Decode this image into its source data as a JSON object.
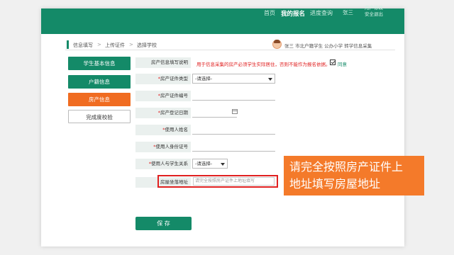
{
  "header": {
    "nav": [
      "首页",
      "我的报名",
      "进度查询"
    ],
    "active_index": 1,
    "user": "张三",
    "right_links": [
      "用户修改",
      "安全退出"
    ]
  },
  "breadcrumb": {
    "items": [
      "信息填写",
      "上传证件",
      "选择学校"
    ],
    "separator": ">",
    "user_info": "张三  市北户籍学生 公办小学 转学信息采集"
  },
  "sidebar": {
    "items": [
      {
        "label": "学生基本信息",
        "style": "green"
      },
      {
        "label": "户籍信息",
        "style": "green"
      },
      {
        "label": "房产信息",
        "style": "orange"
      },
      {
        "label": "完成度校验",
        "style": "plain"
      }
    ]
  },
  "form": {
    "notice_label": "房产信息填写说明",
    "notice_text": "用于信息采集的房产必须学生实际居住，否则不能作为报名依据。",
    "agree_label": "同意",
    "fields": [
      {
        "label": "房产证件类型",
        "required": true,
        "value": "-请选择-"
      },
      {
        "label": "房产证件编号",
        "required": true,
        "value": ""
      },
      {
        "label": "房产登记日期",
        "required": true,
        "value": ""
      },
      {
        "label": "使用人姓名",
        "required": true,
        "value": ""
      },
      {
        "label": "使用人身份证号",
        "required": true,
        "value": ""
      },
      {
        "label": "使用人与学生关系",
        "required": true,
        "value": "-请选择-"
      }
    ],
    "address_label": "房屋坐落地址",
    "address_placeholder": "请完全按照房产证件上地址填写",
    "save_label": "保 存"
  },
  "callout": {
    "lines": [
      "请完全按照房产证件上",
      "地址填写房屋地址"
    ]
  },
  "colors": {
    "primary": "#148a68",
    "accent": "#f06c21",
    "callout": "#f47a2a",
    "error": "#e02020"
  }
}
